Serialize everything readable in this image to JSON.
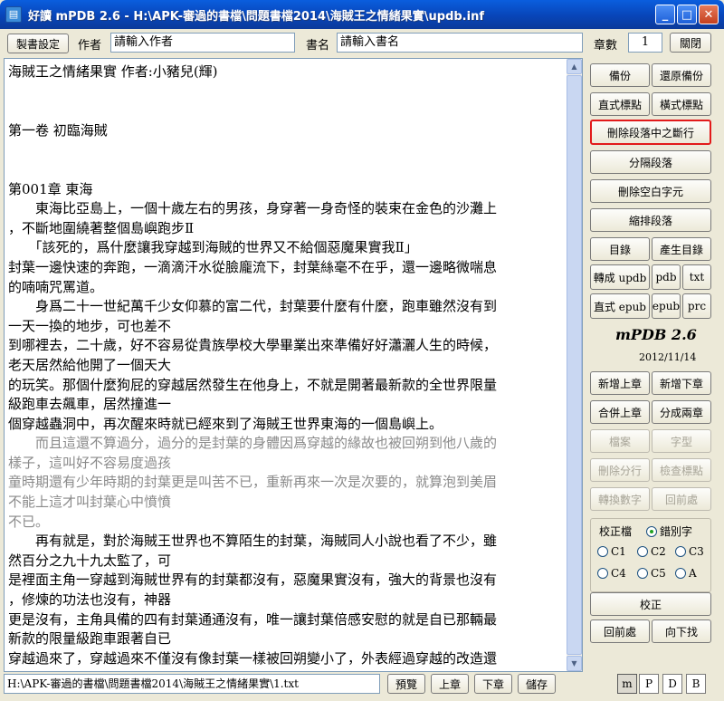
{
  "window": {
    "app_name": "好讀",
    "title": "mPDB 2.6 - H:\\APK-審過的書檔\\問題書檔2014\\海賊王之情緒果實\\updb.inf"
  },
  "toolbar": {
    "make_settings": "製書設定",
    "author_label": "作者",
    "author_input": "請輸入作者",
    "book_title_label": "書名",
    "book_title_input": "請輸入書名",
    "chapter_count_label": "章數",
    "chapter_count_value": "1",
    "close_label": "關閉"
  },
  "text_lines": [
    {
      "t": "海賊王之情緒果實 作者:小豬兒(輝)",
      "faded": false
    },
    {
      "t": "",
      "faded": false
    },
    {
      "t": "",
      "faded": false
    },
    {
      "t": "第一卷 初臨海賊",
      "faded": false
    },
    {
      "t": "",
      "faded": false
    },
    {
      "t": "",
      "faded": false
    },
    {
      "t": "第001章 東海",
      "faded": false
    },
    {
      "t": "　　東海比亞島上，一個十歲左右的男孩，身穿著一身奇怪的裝束在金色的沙灘上",
      "faded": false
    },
    {
      "t": "，不斷地圍繞著整個島嶼跑步Ⅱ",
      "faded": false
    },
    {
      "t": "　　「該死的，爲什麼讓我穿越到海賊的世界又不給個惡魔果實我Ⅱ」",
      "faded": false
    },
    {
      "t": "封葉一邊快速的奔跑，一滴滴汗水從臉龐流下，封葉絲毫不在乎，還一邊略微喘息",
      "faded": false
    },
    {
      "t": "的喃喃咒罵道。",
      "faded": false
    },
    {
      "t": "　　身爲二十一世紀萬千少女仰慕的富二代，封葉要什麼有什麼，跑車雖然沒有到",
      "faded": false
    },
    {
      "t": "一天一換的地步，可也差不",
      "faded": false
    },
    {
      "t": "到哪裡去，二十歲，好不容易從貴族學校大學畢業出來準備好好瀟灑人生的時候，",
      "faded": false
    },
    {
      "t": "老天居然給他開了一個天大",
      "faded": false
    },
    {
      "t": "的玩笑。那個什麼狗屁的穿越居然發生在他身上，不就是開著最新款的全世界限量",
      "faded": false
    },
    {
      "t": "級跑車去飆車，居然撞進一",
      "faded": false
    },
    {
      "t": "個穿越蟲洞中，再次醒來時就已經來到了海賊王世界東海的一個島嶼上。",
      "faded": false
    },
    {
      "t": "　　而且這還不算過分，過分的是封葉的身體因爲穿越的緣故也被回朔到他八歲的",
      "faded": true
    },
    {
      "t": "樣子，這叫好不容易度過孩",
      "faded": true
    },
    {
      "t": "童時期還有少年時期的封葉更是叫苦不已，重新再來一次是次要的，就算泡到美眉",
      "faded": true
    },
    {
      "t": "不能上這才叫封葉心中憤憤",
      "faded": true
    },
    {
      "t": "不已。",
      "faded": true
    },
    {
      "t": "　　再有就是，對於海賊王世界也不算陌生的封葉，海賊同人小說也看了不少，雖",
      "faded": false
    },
    {
      "t": "然百分之九十九太監了，可",
      "faded": false
    },
    {
      "t": "是裡面主角一穿越到海賊世界有的封葉都沒有，惡魔果實沒有，強大的背景也沒有",
      "faded": false
    },
    {
      "t": "，修煉的功法也沒有，神器",
      "faded": false
    },
    {
      "t": "更是沒有，主角具備的四有封葉通通沒有，唯一讓封葉倍感安慰的就是自已那輛最",
      "faded": false
    },
    {
      "t": "新款的限量級跑車跟著自已",
      "faded": false
    },
    {
      "t": "穿越過來了，穿越過來不僅沒有像封葉一樣被回朔變小了，外表經過穿越的改造還",
      "faded": false
    }
  ],
  "side_buttons": {
    "backup": "備份",
    "restore_backup": "還原備份",
    "vertical_punct": "直式標點",
    "horizontal_punct": "橫式標點",
    "remove_line_breaks": "刪除段落中之斷行",
    "split_paragraphs": "分隔段落",
    "remove_blank_chars": "刪除空白字元",
    "indent_paragraphs": "縮排段落",
    "toc": "目錄",
    "generate_toc": "產生目錄",
    "convert_updb": "轉成 updb",
    "pdb": "pdb",
    "txt": "txt",
    "vertical_epub": "直式 epub",
    "epub": "epub",
    "prc": "prc",
    "add_prev_chapter": "新增上章",
    "add_next_chapter": "新增下章",
    "merge_prev_chapter": "合併上章",
    "split_two_chapters": "分成兩章",
    "file": "檔案",
    "font": "字型",
    "remove_split_lines": "刪除分行",
    "check_punct": "檢查標點",
    "convert_digits": "轉換數字",
    "back_prev": "回前處",
    "proofread": "校正",
    "back_prev2": "回前處",
    "find_next": "向下找"
  },
  "about": {
    "product": "mPDB 2.6",
    "date": "2012/11/14"
  },
  "proof_options": {
    "correction_file": "校正檔",
    "wrong_chars": "錯別字",
    "c1": "C1",
    "c2": "C2",
    "c3": "C3",
    "c4": "C4",
    "c5": "C5",
    "a": "A"
  },
  "bottom": {
    "path_value": "H:\\APK-審過的書檔\\問題書檔2014\\海賊王之情緒果實\\1.txt",
    "preview": "預覽",
    "prev_chapter": "上章",
    "next_chapter": "下章",
    "save": "儲存",
    "view_m": "m",
    "view_p": "P",
    "view_d": "D",
    "view_b": "B"
  }
}
